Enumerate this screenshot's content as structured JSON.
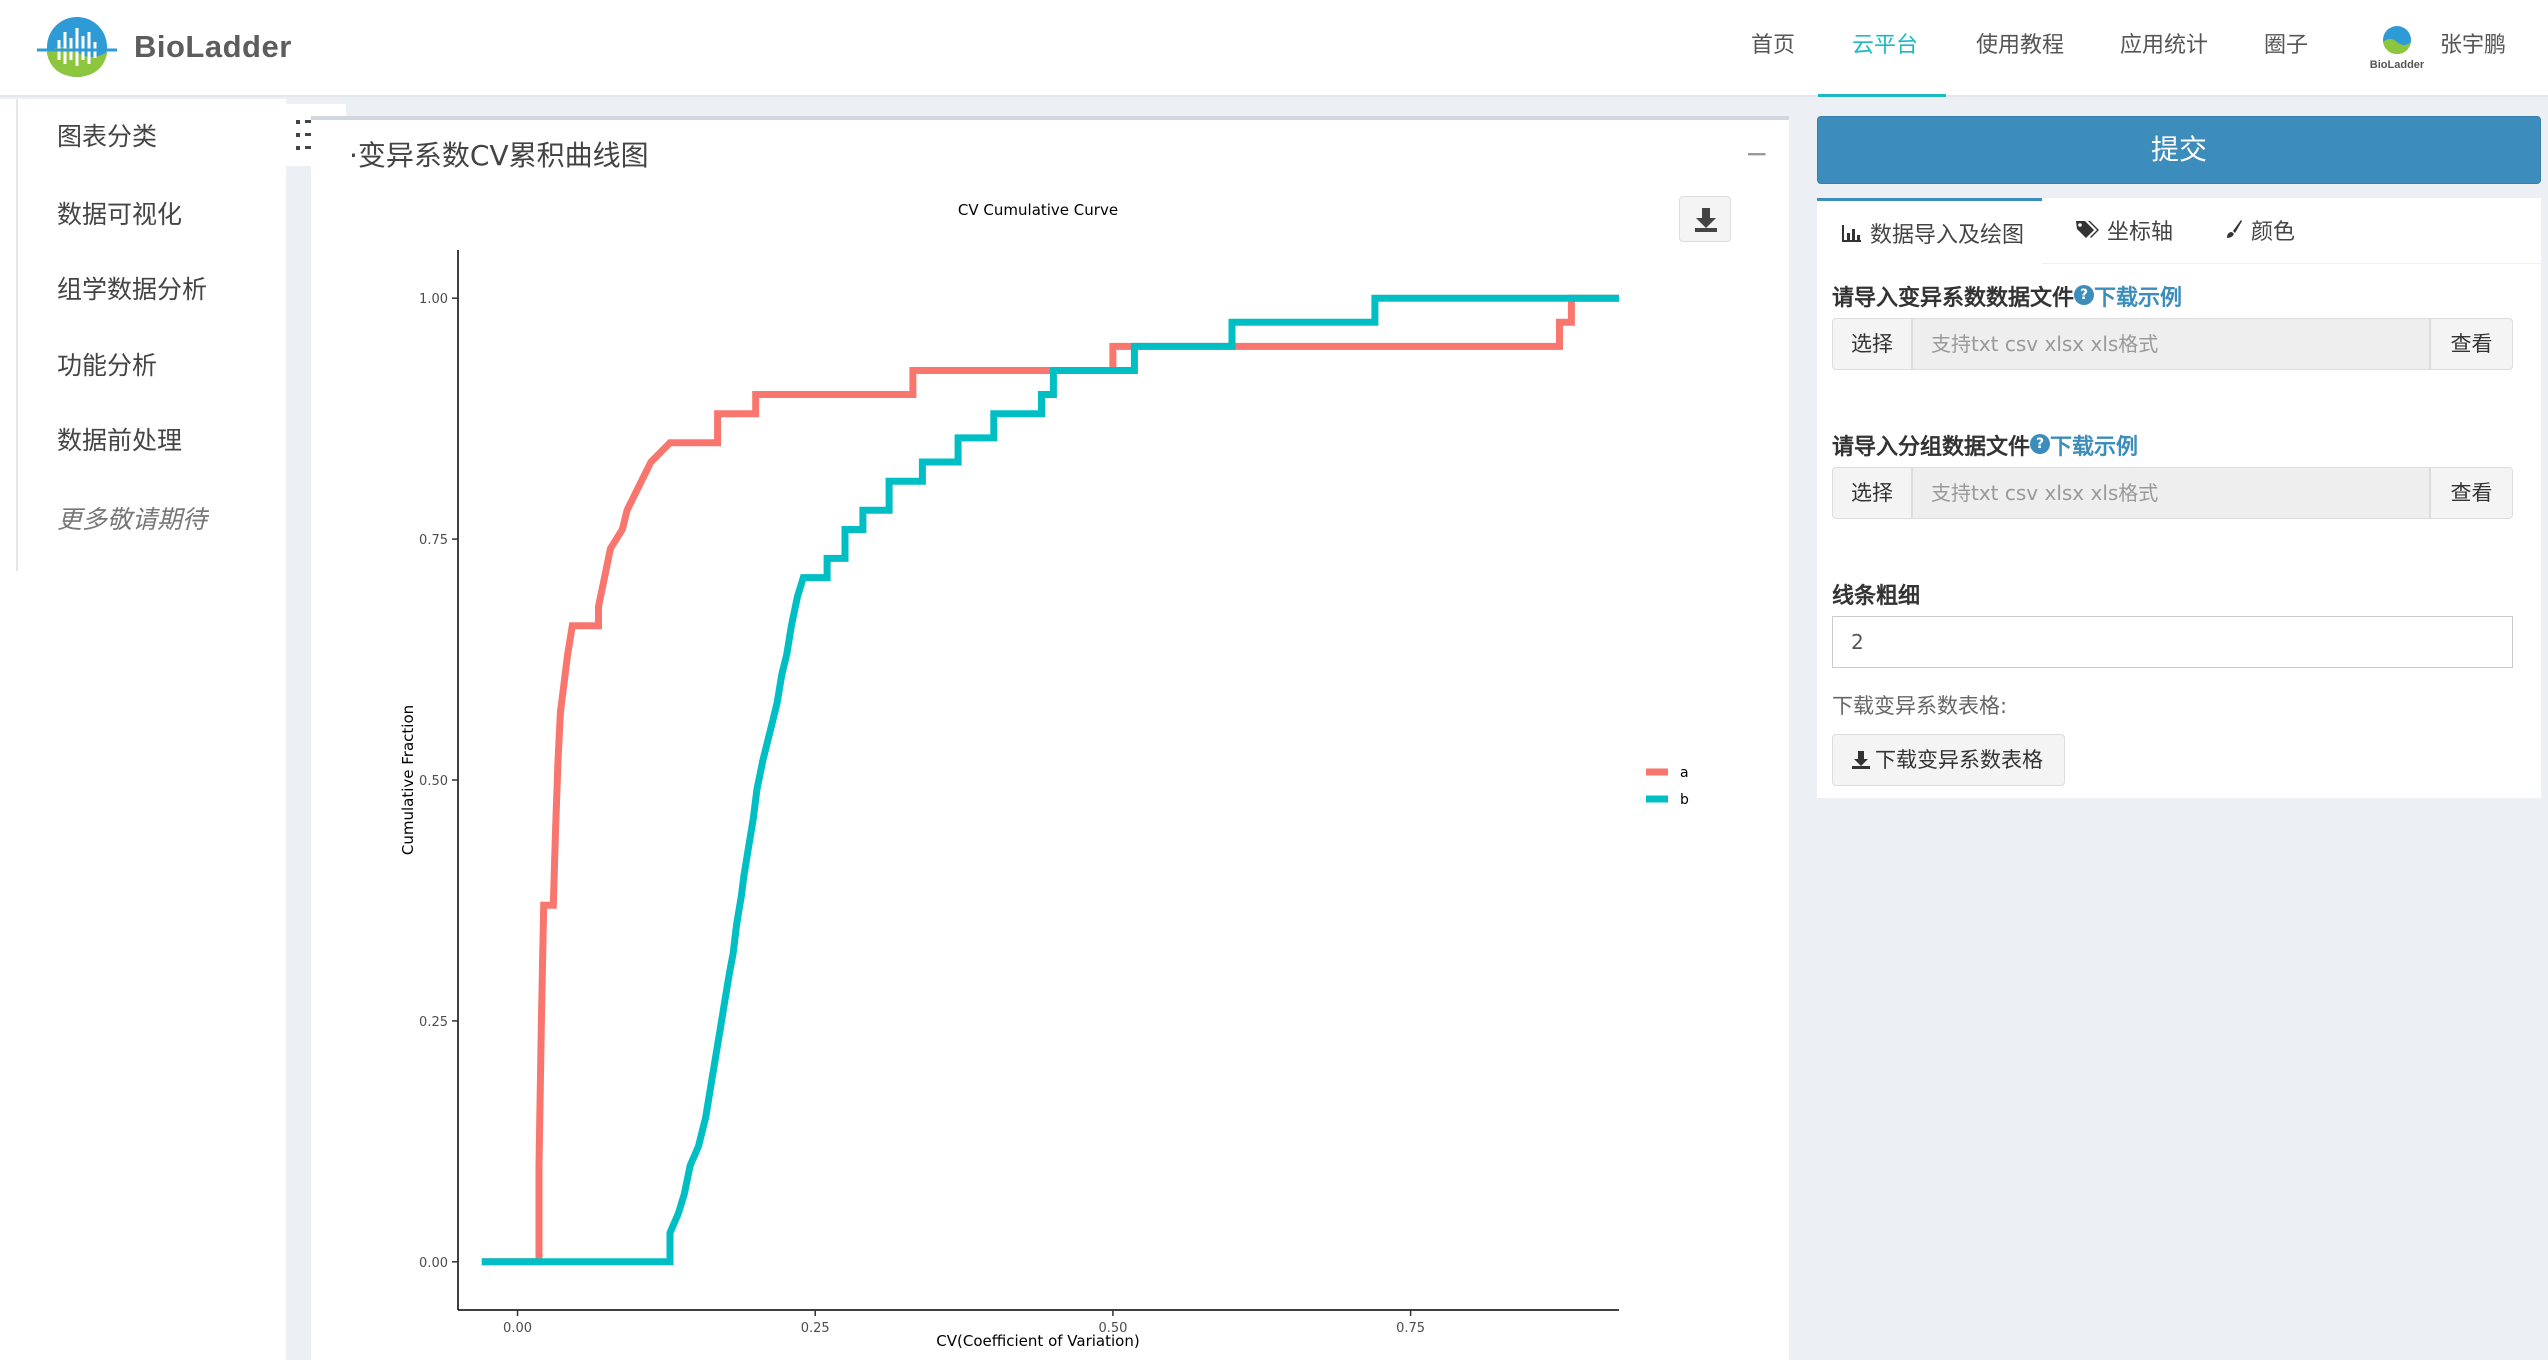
{
  "brand": {
    "name": "BioLadder"
  },
  "nav": {
    "items": [
      {
        "label": "首页"
      },
      {
        "label": "云平台"
      },
      {
        "label": "使用教程"
      },
      {
        "label": "应用统计"
      },
      {
        "label": "圈子"
      }
    ],
    "active_index": 1,
    "user": {
      "avatar_text": "BioLadder",
      "name": "张宇鹏"
    }
  },
  "sidebar": {
    "items": [
      {
        "label": "图表分类"
      },
      {
        "label": "数据可视化"
      },
      {
        "label": "组学数据分析"
      },
      {
        "label": "功能分析"
      },
      {
        "label": "数据前处理"
      },
      {
        "label": "更多敬请期待"
      }
    ]
  },
  "main": {
    "title": "·变异系数CV累积曲线图",
    "collapse_symbol": "−"
  },
  "chart_data": {
    "type": "line",
    "step": true,
    "title": "CV Cumulative Curve",
    "xlabel": "CV(Coefficient of Variation)",
    "ylabel": "Cumulative Fraction",
    "xlim": [
      -0.05,
      0.925
    ],
    "ylim": [
      -0.05,
      1.05
    ],
    "x_ticks": [
      "0.00",
      "0.25",
      "0.50",
      "0.75"
    ],
    "y_ticks": [
      "0.00",
      "0.25",
      "0.50",
      "0.75",
      "1.00"
    ],
    "legend_position": "right",
    "series": [
      {
        "name": "a",
        "color": "#F8766D",
        "points": [
          [
            -0.03,
            0.0
          ],
          [
            0.018,
            0.0
          ],
          [
            0.018,
            0.1
          ],
          [
            0.02,
            0.25
          ],
          [
            0.022,
            0.37
          ],
          [
            0.03,
            0.37
          ],
          [
            0.032,
            0.45
          ],
          [
            0.034,
            0.52
          ],
          [
            0.036,
            0.57
          ],
          [
            0.04,
            0.61
          ],
          [
            0.042,
            0.63
          ],
          [
            0.046,
            0.66
          ],
          [
            0.068,
            0.66
          ],
          [
            0.068,
            0.68
          ],
          [
            0.073,
            0.71
          ],
          [
            0.078,
            0.74
          ],
          [
            0.088,
            0.76
          ],
          [
            0.092,
            0.78
          ],
          [
            0.1,
            0.8
          ],
          [
            0.112,
            0.83
          ],
          [
            0.128,
            0.85
          ],
          [
            0.168,
            0.85
          ],
          [
            0.168,
            0.88
          ],
          [
            0.2,
            0.88
          ],
          [
            0.2,
            0.9
          ],
          [
            0.332,
            0.9
          ],
          [
            0.332,
            0.925
          ],
          [
            0.5,
            0.925
          ],
          [
            0.5,
            0.95
          ],
          [
            0.875,
            0.95
          ],
          [
            0.875,
            0.975
          ],
          [
            0.885,
            0.975
          ],
          [
            0.885,
            1.0
          ],
          [
            0.925,
            1.0
          ]
        ]
      },
      {
        "name": "b",
        "color": "#00BFC4",
        "points": [
          [
            -0.03,
            0.0
          ],
          [
            0.128,
            0.0
          ],
          [
            0.128,
            0.03
          ],
          [
            0.135,
            0.05
          ],
          [
            0.14,
            0.07
          ],
          [
            0.145,
            0.1
          ],
          [
            0.152,
            0.12
          ],
          [
            0.158,
            0.15
          ],
          [
            0.162,
            0.18
          ],
          [
            0.166,
            0.21
          ],
          [
            0.17,
            0.24
          ],
          [
            0.174,
            0.27
          ],
          [
            0.178,
            0.3
          ],
          [
            0.181,
            0.32
          ],
          [
            0.184,
            0.35
          ],
          [
            0.188,
            0.38
          ],
          [
            0.19,
            0.4
          ],
          [
            0.194,
            0.43
          ],
          [
            0.198,
            0.46
          ],
          [
            0.201,
            0.49
          ],
          [
            0.206,
            0.52
          ],
          [
            0.212,
            0.55
          ],
          [
            0.218,
            0.58
          ],
          [
            0.222,
            0.61
          ],
          [
            0.226,
            0.63
          ],
          [
            0.23,
            0.66
          ],
          [
            0.235,
            0.69
          ],
          [
            0.24,
            0.71
          ],
          [
            0.26,
            0.71
          ],
          [
            0.26,
            0.73
          ],
          [
            0.275,
            0.73
          ],
          [
            0.275,
            0.76
          ],
          [
            0.29,
            0.76
          ],
          [
            0.29,
            0.78
          ],
          [
            0.312,
            0.78
          ],
          [
            0.312,
            0.81
          ],
          [
            0.34,
            0.81
          ],
          [
            0.34,
            0.83
          ],
          [
            0.37,
            0.83
          ],
          [
            0.37,
            0.855
          ],
          [
            0.4,
            0.855
          ],
          [
            0.4,
            0.88
          ],
          [
            0.44,
            0.88
          ],
          [
            0.44,
            0.9
          ],
          [
            0.45,
            0.9
          ],
          [
            0.45,
            0.925
          ],
          [
            0.518,
            0.925
          ],
          [
            0.518,
            0.95
          ],
          [
            0.6,
            0.95
          ],
          [
            0.6,
            0.975
          ],
          [
            0.72,
            0.975
          ],
          [
            0.72,
            1.0
          ],
          [
            0.925,
            1.0
          ]
        ]
      }
    ]
  },
  "form": {
    "submit_label": "提交",
    "tabs": [
      {
        "label": "数据导入及绘图",
        "icon": "bar-chart-icon"
      },
      {
        "label": "坐标轴",
        "icon": "tags-icon"
      },
      {
        "label": "颜色",
        "icon": "paint-brush-icon"
      }
    ],
    "cv_file": {
      "label": "请导入变异系数数据文件",
      "help": "?",
      "example_link": "下载示例",
      "choose_label": "选择",
      "placeholder": "支持txt csv xlsx xls格式",
      "view_label": "查看"
    },
    "group_file": {
      "label": "请导入分组数据文件",
      "help": "?",
      "example_link": "下载示例",
      "choose_label": "选择",
      "placeholder": "支持txt csv xlsx xls格式",
      "view_label": "查看"
    },
    "line_width": {
      "label": "线条粗细",
      "value": "2"
    },
    "download": {
      "label": "下载变异系数表格:",
      "button_label": "下载变异系数表格"
    }
  }
}
